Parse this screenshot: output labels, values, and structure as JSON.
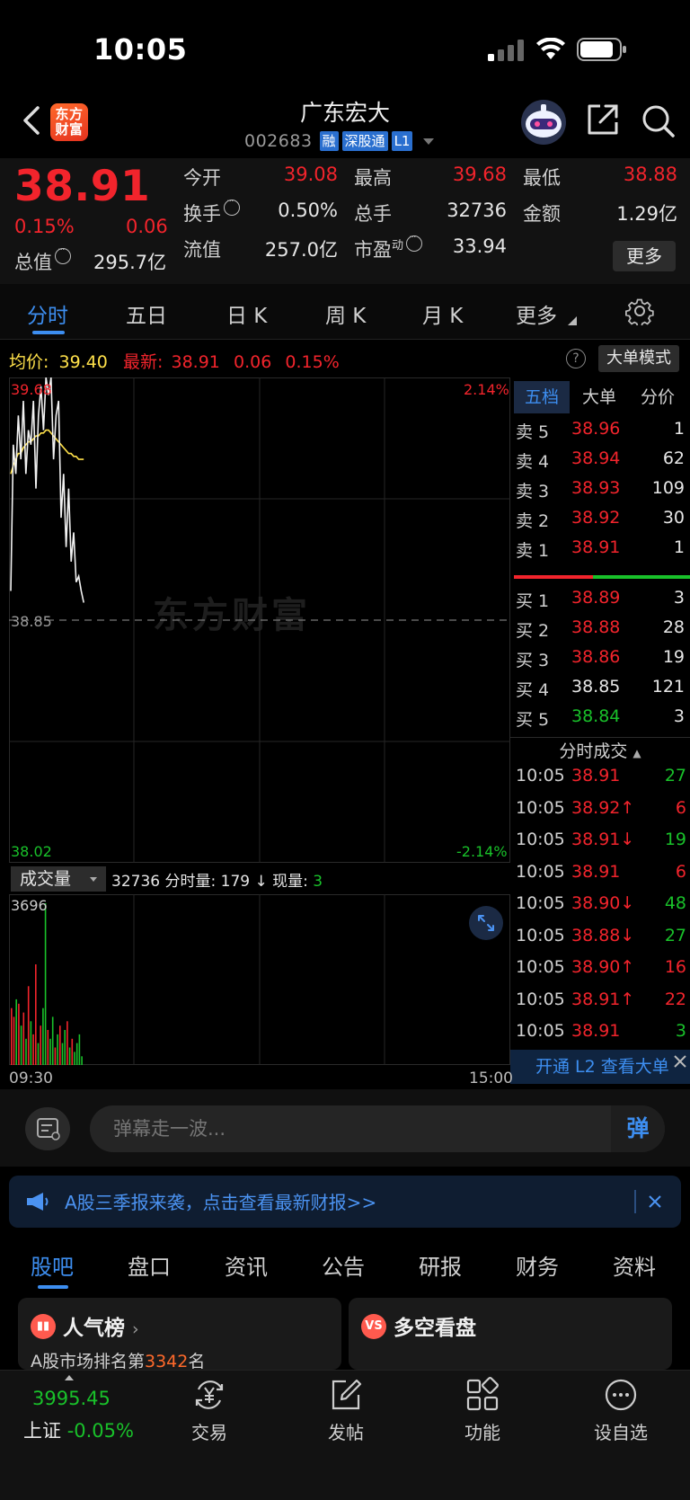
{
  "status": {
    "time": "10:05"
  },
  "header": {
    "logo_line1": "东方",
    "logo_line2": "财富",
    "stock_name": "广东宏大",
    "stock_code": "002683",
    "tags": [
      "融",
      "深股通",
      "L1"
    ]
  },
  "quote": {
    "last_price": "38.91",
    "change_pct": "0.15%",
    "change": "0.06",
    "open_label": "今开",
    "open": "39.08",
    "high_label": "最高",
    "high": "39.68",
    "low_label": "最低",
    "low": "38.88",
    "turnover_label": "换手",
    "turnover": "0.50%",
    "volume_label": "总手",
    "volume": "32736",
    "amount_label": "金额",
    "amount": "1.29亿",
    "mktcap_label": "总值",
    "mktcap": "295.7亿",
    "float_label": "流值",
    "float": "257.0亿",
    "pe_label": "市盈",
    "pe_sup": "动",
    "pe": "33.94",
    "more_label": "更多"
  },
  "chart_tabs": [
    "分时",
    "五日",
    "日 K",
    "周 K",
    "月 K",
    "更多"
  ],
  "avg_row": {
    "avg_label": "均价:",
    "avg_value": "39.40",
    "latest_label": "最新:",
    "latest_price": "38.91",
    "latest_change": "0.06",
    "latest_pct": "0.15%",
    "big_mode": "大单模式"
  },
  "price_axis": {
    "top": "39.68",
    "mid": "38.85",
    "bottom": "38.02",
    "top_pct": "2.14%",
    "bottom_pct": "-2.14%"
  },
  "watermark": "东方财富",
  "book": {
    "tabs": [
      "五档",
      "大单",
      "分价"
    ],
    "asks": [
      {
        "label": "卖 5",
        "price": "38.96",
        "vol": "1"
      },
      {
        "label": "卖 4",
        "price": "38.94",
        "vol": "62"
      },
      {
        "label": "卖 3",
        "price": "38.93",
        "vol": "109"
      },
      {
        "label": "卖 2",
        "price": "38.92",
        "vol": "30"
      },
      {
        "label": "卖 1",
        "price": "38.91",
        "vol": "1"
      }
    ],
    "bids": [
      {
        "label": "买 1",
        "price": "38.89",
        "vol": "3",
        "color": "#f2242c"
      },
      {
        "label": "买 2",
        "price": "38.88",
        "vol": "28",
        "color": "#f2242c"
      },
      {
        "label": "买 3",
        "price": "38.86",
        "vol": "19",
        "color": "#f2242c"
      },
      {
        "label": "买 4",
        "price": "38.85",
        "vol": "121",
        "color": "#e6e6e6"
      },
      {
        "label": "买 5",
        "price": "38.84",
        "vol": "3",
        "color": "#19c12a"
      }
    ]
  },
  "ticks": {
    "header": "分时成交",
    "rows": [
      {
        "time": "10:05",
        "price": "38.91",
        "dir": "",
        "vol": "27",
        "vcolor": "#19c12a"
      },
      {
        "time": "10:05",
        "price": "38.92",
        "dir": "↑",
        "vol": "6",
        "vcolor": "#f2242c"
      },
      {
        "time": "10:05",
        "price": "38.91",
        "dir": "↓",
        "vol": "19",
        "vcolor": "#19c12a"
      },
      {
        "time": "10:05",
        "price": "38.91",
        "dir": "",
        "vol": "6",
        "vcolor": "#f2242c"
      },
      {
        "time": "10:05",
        "price": "38.90",
        "dir": "↓",
        "vol": "48",
        "vcolor": "#19c12a"
      },
      {
        "time": "10:05",
        "price": "38.88",
        "dir": "↓",
        "vol": "27",
        "vcolor": "#19c12a"
      },
      {
        "time": "10:05",
        "price": "38.90",
        "dir": "↑",
        "vol": "16",
        "vcolor": "#f2242c"
      },
      {
        "time": "10:05",
        "price": "38.91",
        "dir": "↑",
        "vol": "22",
        "vcolor": "#f2242c"
      },
      {
        "time": "10:05",
        "price": "38.91",
        "dir": "",
        "vol": "3",
        "vcolor": "#19c12a"
      }
    ],
    "l2_banner": "开通 L2 查看大单"
  },
  "volume": {
    "select_label": "成交量",
    "total": "32736",
    "minute_label": "分时量:",
    "minute_vol": "179",
    "minute_dir": "↓",
    "now_label": "现量:",
    "now_vol": "3",
    "max_label": "3696",
    "t_start": "09:30",
    "t_end": "15:00"
  },
  "danmaku": {
    "placeholder": "弹幕走一波...",
    "send": "弹"
  },
  "announce": {
    "text": "A股三季报来袭，点击查看最新财报>>"
  },
  "sub_tabs": [
    "股吧",
    "盘口",
    "资讯",
    "公告",
    "研报",
    "财务",
    "资料"
  ],
  "cards": {
    "popular_title": "人气榜",
    "popular_sub_prefix": "A股市场排名第",
    "popular_rank": "3342",
    "popular_sub_suffix": "名",
    "bullbear_title": "多空看盘",
    "bullbear_icon": "VS"
  },
  "nav": {
    "index_value": "3995.45",
    "index_name": "上证",
    "index_change": "-0.05%",
    "items": [
      "交易",
      "发帖",
      "功能",
      "设自选"
    ]
  },
  "chart_data": {
    "type": "line",
    "x_range": [
      "09:30",
      "15:00"
    ],
    "ylim": [
      38.02,
      39.68
    ],
    "reference_price": 38.85,
    "series": [
      {
        "values": [
          38.95,
          39.45,
          39.35,
          39.55,
          39.4,
          39.6,
          39.35,
          39.5,
          39.45,
          39.6,
          39.3,
          39.55,
          39.65,
          39.5,
          39.68,
          39.62,
          39.68,
          39.4,
          39.55,
          39.6,
          39.2,
          39.35,
          39.1,
          39.3,
          39.05,
          39.15,
          38.98,
          39.0,
          38.95,
          38.91
        ]
      },
      {
        "values": [
          39.35,
          39.38,
          39.4,
          39.42,
          39.42,
          39.44,
          39.45,
          39.46,
          39.46,
          39.47,
          39.48,
          39.48,
          39.49,
          39.49,
          39.5,
          39.5,
          39.49,
          39.48,
          39.47,
          39.46,
          39.45,
          39.44,
          39.43,
          39.42,
          39.42,
          39.41,
          39.41,
          39.4,
          39.4,
          39.4
        ]
      }
    ],
    "volume": {
      "max": 3696,
      "bars": [
        1300,
        1100,
        1500,
        1400,
        900,
        1200,
        600,
        1800,
        1000,
        700,
        2300,
        500,
        900,
        1300,
        3696,
        800,
        600,
        1100,
        400,
        700,
        900,
        500,
        800,
        1000,
        400,
        600,
        300,
        500,
        700,
        200
      ],
      "colors": [
        "r",
        "r",
        "g",
        "r",
        "g",
        "r",
        "g",
        "r",
        "g",
        "r",
        "r",
        "g",
        "r",
        "g",
        "g",
        "r",
        "g",
        "g",
        "r",
        "g",
        "r",
        "g",
        "g",
        "r",
        "g",
        "r",
        "g",
        "g",
        "g",
        "g"
      ]
    }
  }
}
